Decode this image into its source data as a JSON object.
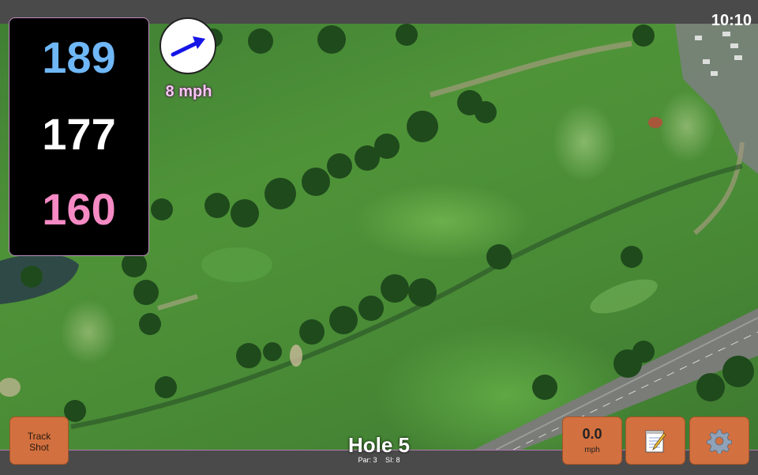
{
  "status": {
    "clock": "10:10"
  },
  "distances": {
    "back": "189",
    "middle": "177",
    "front": "160"
  },
  "wind": {
    "speed": "8 mph",
    "direction_icon": "arrow-right-icon"
  },
  "hole": {
    "title": "Hole 5",
    "par": "Par: 3",
    "si": "SI: 8"
  },
  "buttons": {
    "track_shot_line1": "Track",
    "track_shot_line2": "Shot",
    "speed_value": "0.0",
    "speed_unit": "mph",
    "notes_icon": "notepad-icon",
    "settings_icon": "gear-icon"
  },
  "colors": {
    "back_distance": "#6fb7f7",
    "middle_distance": "#ffffff",
    "front_distance": "#f58ac4",
    "button": "#d2703f",
    "wind_arrow": "#1515e6"
  }
}
